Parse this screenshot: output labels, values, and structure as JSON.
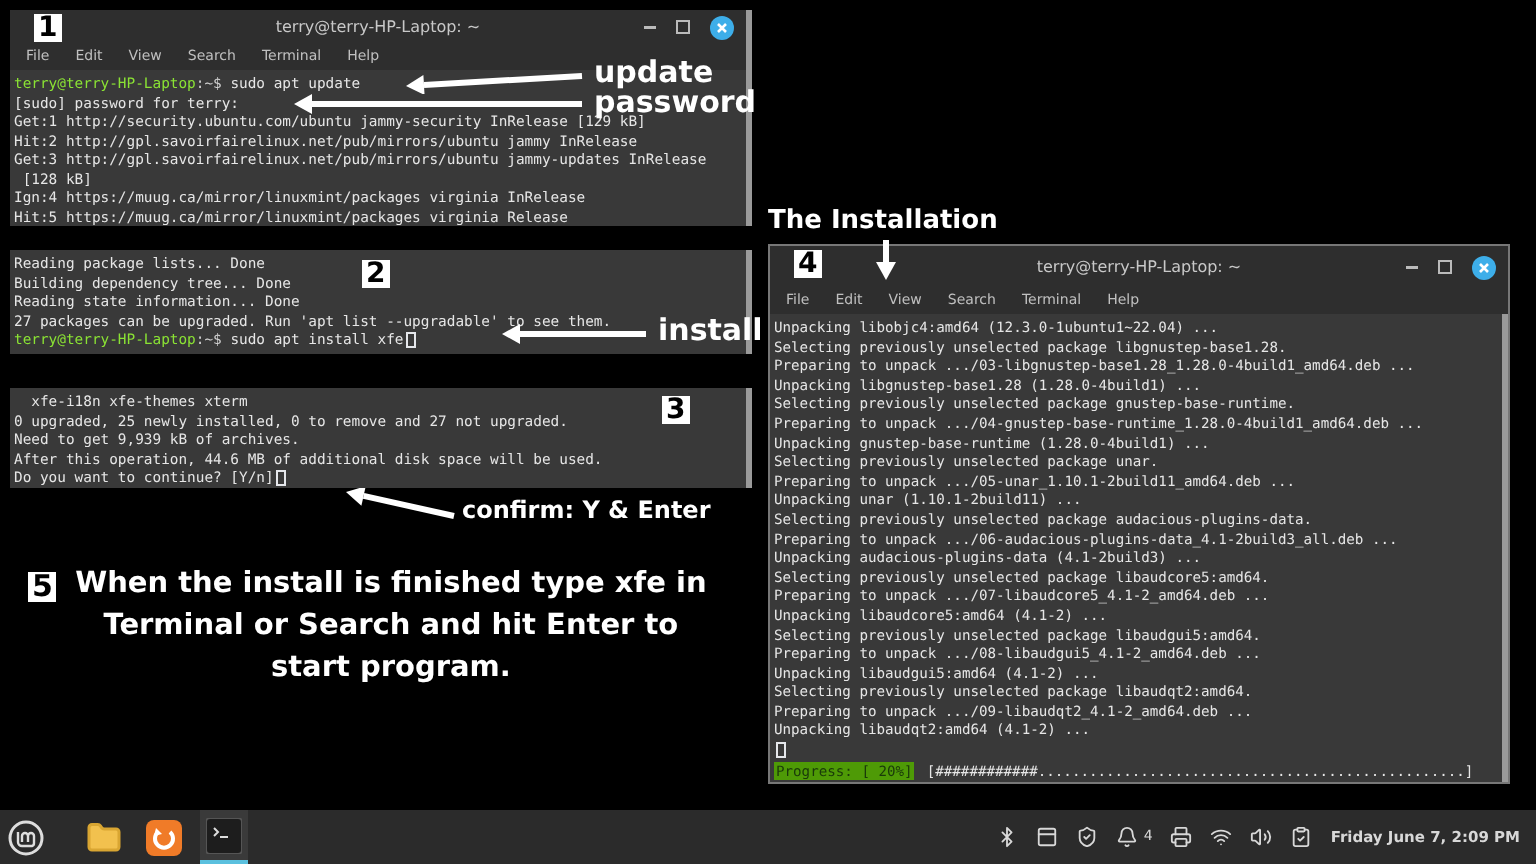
{
  "snippets": [
    {
      "badge": "1",
      "window": {
        "title": "terry@terry-HP-Laptop: ~",
        "menu": [
          "File",
          "Edit",
          "View",
          "Search",
          "Terminal",
          "Help"
        ]
      },
      "lines": [
        {
          "kind": "prompt",
          "user": "terry@terry-HP-Laptop",
          "sep": ":~$ ",
          "text": "sudo apt update",
          "cursor": false
        },
        {
          "kind": "text",
          "text": "[sudo] password for terry:",
          "cursor": false
        },
        {
          "kind": "text",
          "text": "Get:1 http://security.ubuntu.com/ubuntu jammy-security InRelease [129 kB]",
          "cursor": false
        },
        {
          "kind": "text",
          "text": "Hit:2 http://gpl.savoirfairelinux.net/pub/mirrors/ubuntu jammy InRelease",
          "cursor": false
        },
        {
          "kind": "text",
          "text": "Get:3 http://gpl.savoirfairelinux.net/pub/mirrors/ubuntu jammy-updates InRelease",
          "cursor": false
        },
        {
          "kind": "text",
          "text": " [128 kB]",
          "cursor": false
        },
        {
          "kind": "text",
          "text": "Ign:4 https://muug.ca/mirror/linuxmint/packages virginia InRelease",
          "cursor": false
        },
        {
          "kind": "text",
          "text": "Hit:5 https://muug.ca/mirror/linuxmint/packages virginia Release",
          "cursor": false
        }
      ],
      "annotations": [
        "update",
        "password"
      ]
    },
    {
      "badge": "2",
      "lines": [
        {
          "kind": "text",
          "text": "Reading package lists... Done",
          "cursor": false
        },
        {
          "kind": "text",
          "text": "Building dependency tree... Done",
          "cursor": false
        },
        {
          "kind": "text",
          "text": "Reading state information... Done",
          "cursor": false
        },
        {
          "kind": "text",
          "text": "27 packages can be upgraded. Run 'apt list --upgradable' to see them.",
          "cursor": false
        },
        {
          "kind": "prompt",
          "user": "terry@terry-HP-Laptop",
          "sep": ":~$ ",
          "text": "sudo apt install xfe",
          "cursor": true
        }
      ],
      "annotations": [
        "install"
      ]
    },
    {
      "badge": "3",
      "lines": [
        {
          "kind": "text",
          "text": "  xfe-i18n xfe-themes xterm",
          "cursor": false
        },
        {
          "kind": "text",
          "text": "0 upgraded, 25 newly installed, 0 to remove and 27 not upgraded.",
          "cursor": false
        },
        {
          "kind": "text",
          "text": "Need to get 9,939 kB of archives.",
          "cursor": false
        },
        {
          "kind": "text",
          "text": "After this operation, 44.6 MB of additional disk space will be used.",
          "cursor": false
        },
        {
          "kind": "text",
          "text": "Do you want to continue? [Y/n]",
          "cursor": true
        }
      ],
      "annotations": [
        "confirm: Y & Enter"
      ]
    }
  ],
  "instruction": {
    "badge": "5",
    "text": "When the install is finished type xfe in Terminal or Search and hit Enter to start program."
  },
  "installation": {
    "heading": "The Installation",
    "badge": "4",
    "window": {
      "title": "terry@terry-HP-Laptop: ~",
      "menu": [
        "File",
        "Edit",
        "View",
        "Search",
        "Terminal",
        "Help"
      ]
    },
    "lines": [
      {
        "kind": "text",
        "text": "Unpacking libobjc4:amd64 (12.3.0-1ubuntu1~22.04) ...",
        "cursor": false
      },
      {
        "kind": "text",
        "text": "Selecting previously unselected package libgnustep-base1.28.",
        "cursor": false
      },
      {
        "kind": "text",
        "text": "Preparing to unpack .../03-libgnustep-base1.28_1.28.0-4build1_amd64.deb ...",
        "cursor": false
      },
      {
        "kind": "text",
        "text": "Unpacking libgnustep-base1.28 (1.28.0-4build1) ...",
        "cursor": false
      },
      {
        "kind": "text",
        "text": "Selecting previously unselected package gnustep-base-runtime.",
        "cursor": false
      },
      {
        "kind": "text",
        "text": "Preparing to unpack .../04-gnustep-base-runtime_1.28.0-4build1_amd64.deb ...",
        "cursor": false
      },
      {
        "kind": "text",
        "text": "Unpacking gnustep-base-runtime (1.28.0-4build1) ...",
        "cursor": false
      },
      {
        "kind": "text",
        "text": "Selecting previously unselected package unar.",
        "cursor": false
      },
      {
        "kind": "text",
        "text": "Preparing to unpack .../05-unar_1.10.1-2build11_amd64.deb ...",
        "cursor": false
      },
      {
        "kind": "text",
        "text": "Unpacking unar (1.10.1-2build11) ...",
        "cursor": false
      },
      {
        "kind": "text",
        "text": "Selecting previously unselected package audacious-plugins-data.",
        "cursor": false
      },
      {
        "kind": "text",
        "text": "Preparing to unpack .../06-audacious-plugins-data_4.1-2build3_all.deb ...",
        "cursor": false
      },
      {
        "kind": "text",
        "text": "Unpacking audacious-plugins-data (4.1-2build3) ...",
        "cursor": false
      },
      {
        "kind": "text",
        "text": "Selecting previously unselected package libaudcore5:amd64.",
        "cursor": false
      },
      {
        "kind": "text",
        "text": "Preparing to unpack .../07-libaudcore5_4.1-2_amd64.deb ...",
        "cursor": false
      },
      {
        "kind": "text",
        "text": "Unpacking libaudcore5:amd64 (4.1-2) ...",
        "cursor": false
      },
      {
        "kind": "text",
        "text": "Selecting previously unselected package libaudgui5:amd64.",
        "cursor": false
      },
      {
        "kind": "text",
        "text": "Preparing to unpack .../08-libaudgui5_4.1-2_amd64.deb ...",
        "cursor": false
      },
      {
        "kind": "text",
        "text": "Unpacking libaudgui5:amd64 (4.1-2) ...",
        "cursor": false
      },
      {
        "kind": "text",
        "text": "Selecting previously unselected package libaudqt2:amd64.",
        "cursor": false
      },
      {
        "kind": "text",
        "text": "Preparing to unpack .../09-libaudqt2_4.1-2_amd64.deb ...",
        "cursor": false
      },
      {
        "kind": "text",
        "text": "Unpacking libaudqt2:amd64 (4.1-2) ...",
        "cursor": false
      },
      {
        "kind": "cursor_line",
        "cursor": true
      }
    ],
    "progress": {
      "label": "Progress: [ 20%]",
      "bar": "[############..................................................]"
    }
  },
  "taskbar": {
    "apps": [
      {
        "kind": "files",
        "active": false
      },
      {
        "kind": "updates",
        "active": false
      },
      {
        "kind": "terminal",
        "active": true
      }
    ],
    "notification_count": "4",
    "clock": "Friday June 7, 2:09 PM"
  }
}
